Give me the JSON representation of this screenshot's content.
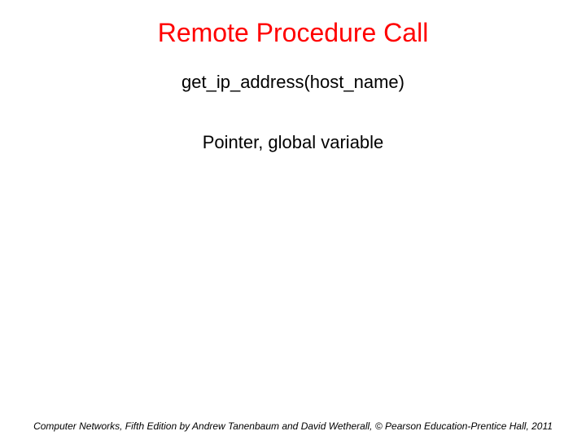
{
  "title": "Remote Procedure Call",
  "body": {
    "line1": "get_ip_address(host_name)",
    "line2": "Pointer, global variable"
  },
  "footer": "Computer Networks, Fifth Edition by Andrew Tanenbaum and David Wetherall, © Pearson Education-Prentice Hall, 2011"
}
